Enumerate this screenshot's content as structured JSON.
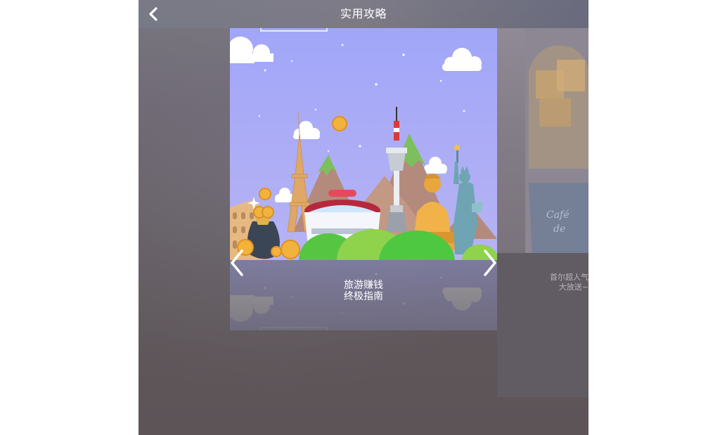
{
  "header": {
    "title": "实用攻略",
    "back_icon": "chevron-left-icon"
  },
  "carousel": {
    "current": {
      "caption_line1": "旅游赚钱",
      "caption_line2": "终极指南"
    },
    "next_peek": {
      "text_line1": "首尔超人气",
      "text_line2": "大放送~"
    },
    "prev_icon": "chevron-left-icon",
    "next_icon": "chevron-right-icon"
  },
  "colors": {
    "sky": "#a7aef8",
    "ground_green": "#53c94a",
    "title_text": "#ffffff"
  }
}
